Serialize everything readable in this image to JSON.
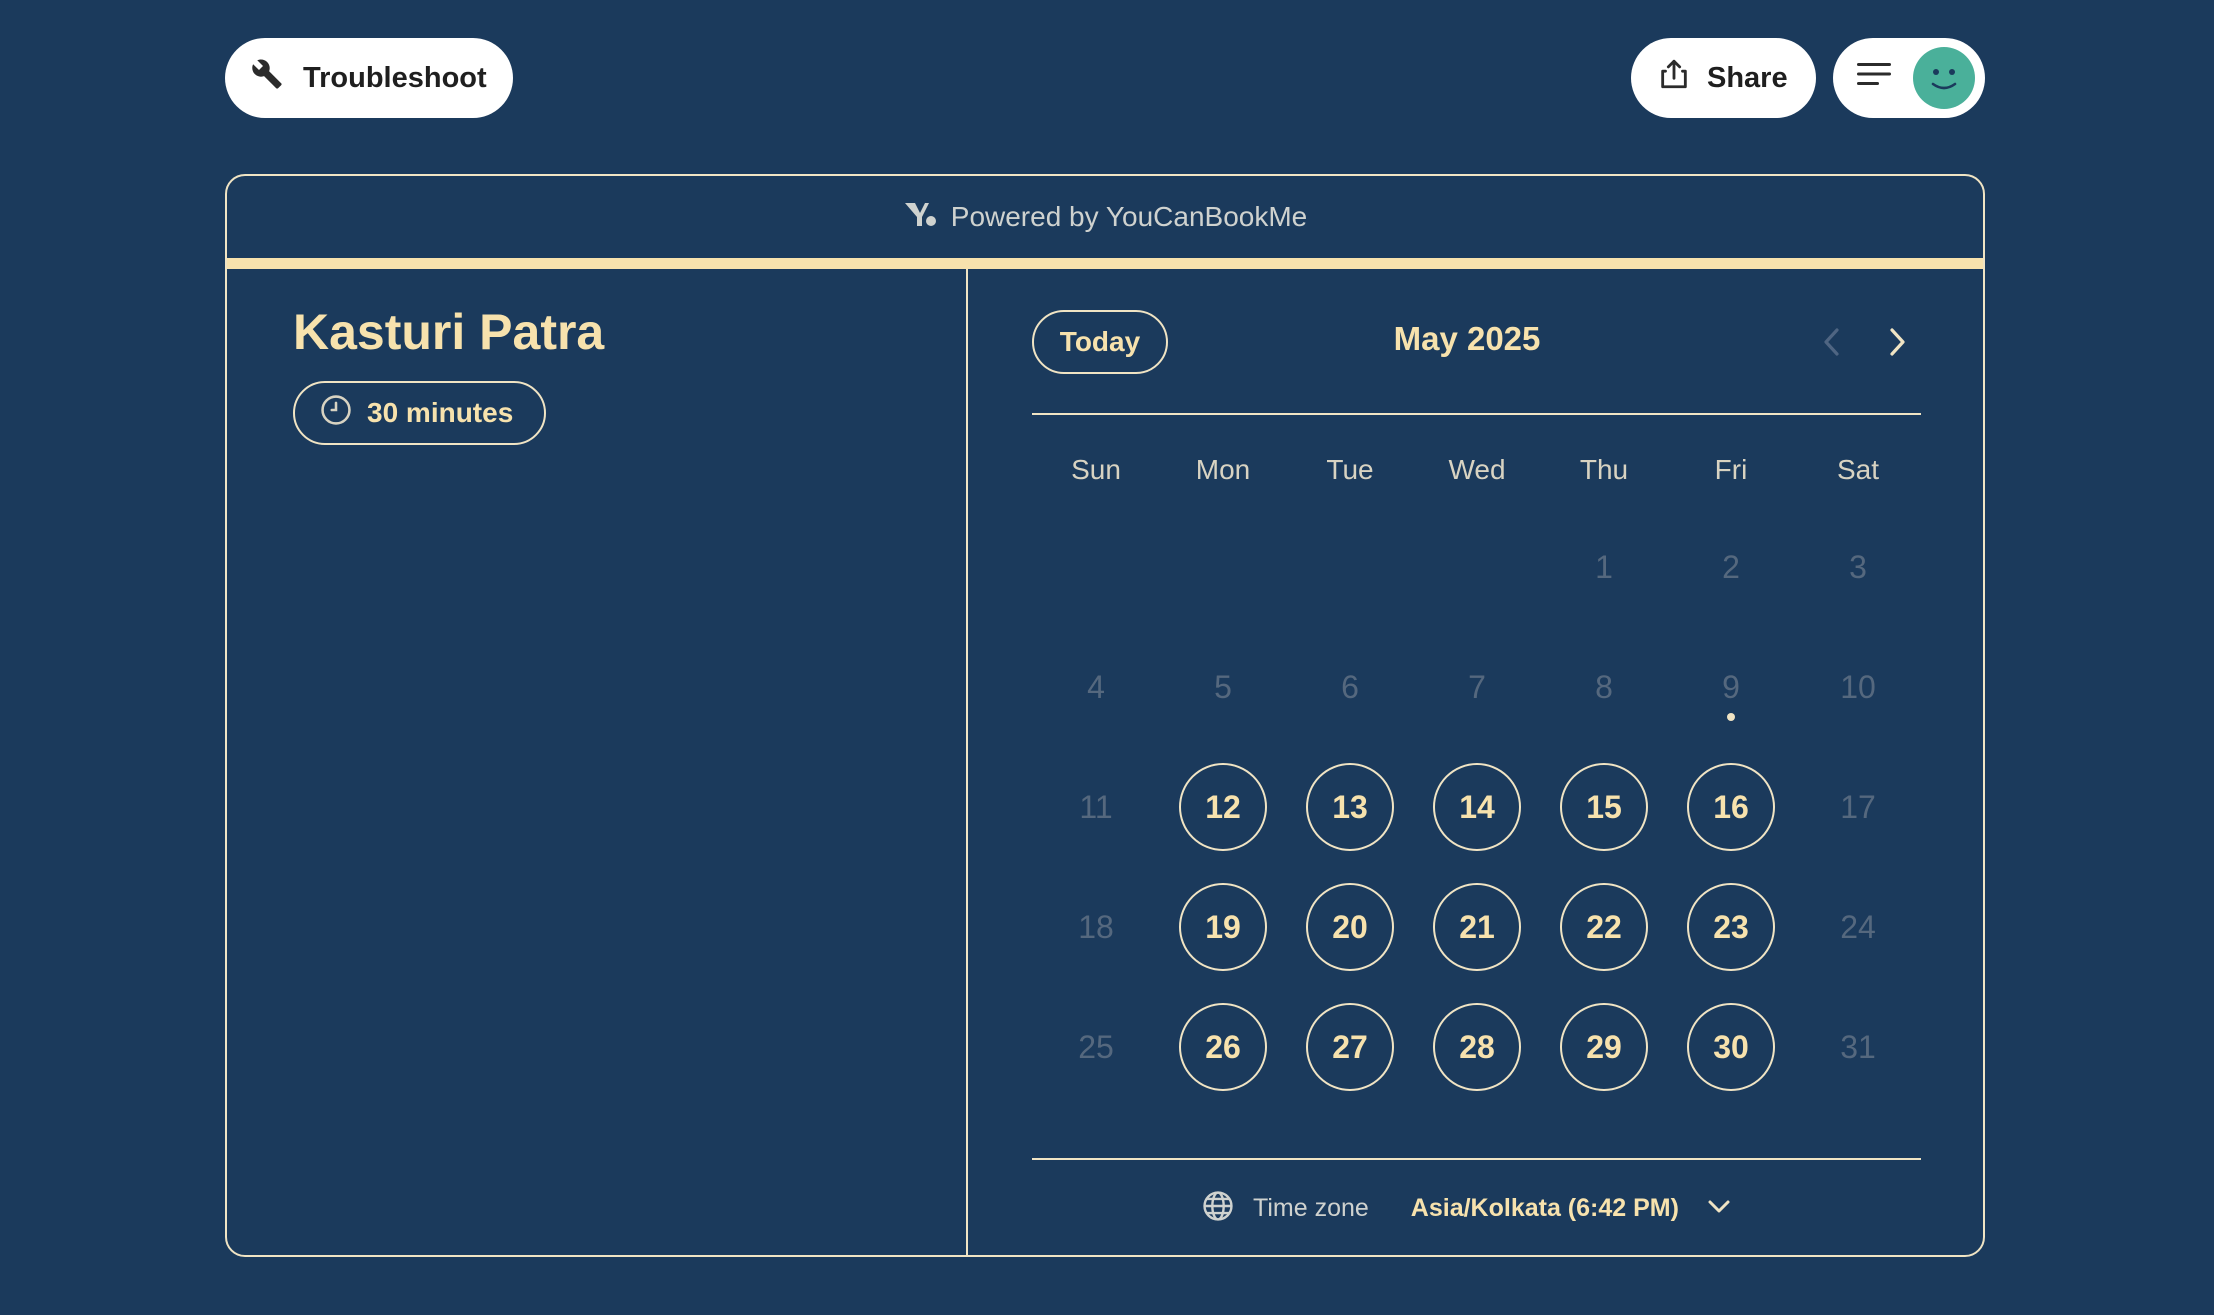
{
  "header": {
    "troubleshoot_label": "Troubleshoot",
    "share_label": "Share"
  },
  "powered_by": "Powered by YouCanBookMe",
  "host": {
    "name": "Kasturi Patra",
    "duration": "30 minutes"
  },
  "calendar": {
    "today_label": "Today",
    "month_title": "May 2025",
    "weekdays": [
      "Sun",
      "Mon",
      "Tue",
      "Wed",
      "Thu",
      "Fri",
      "Sat"
    ],
    "weeks": [
      [
        null,
        null,
        null,
        null,
        1,
        2,
        3
      ],
      [
        4,
        5,
        6,
        7,
        8,
        9,
        10
      ],
      [
        11,
        12,
        13,
        14,
        15,
        16,
        17
      ],
      [
        18,
        19,
        20,
        21,
        22,
        23,
        24
      ],
      [
        25,
        26,
        27,
        28,
        29,
        30,
        31
      ]
    ],
    "available_days": [
      12,
      13,
      14,
      15,
      16,
      19,
      20,
      21,
      22,
      23,
      26,
      27,
      28,
      29,
      30
    ],
    "today": 9
  },
  "timezone": {
    "label": "Time zone",
    "value": "Asia/Kolkata (6:42 PM)"
  },
  "colors": {
    "background": "#1b3a5c",
    "accent": "#f7e2ad",
    "avatar": "#4ab09a"
  }
}
